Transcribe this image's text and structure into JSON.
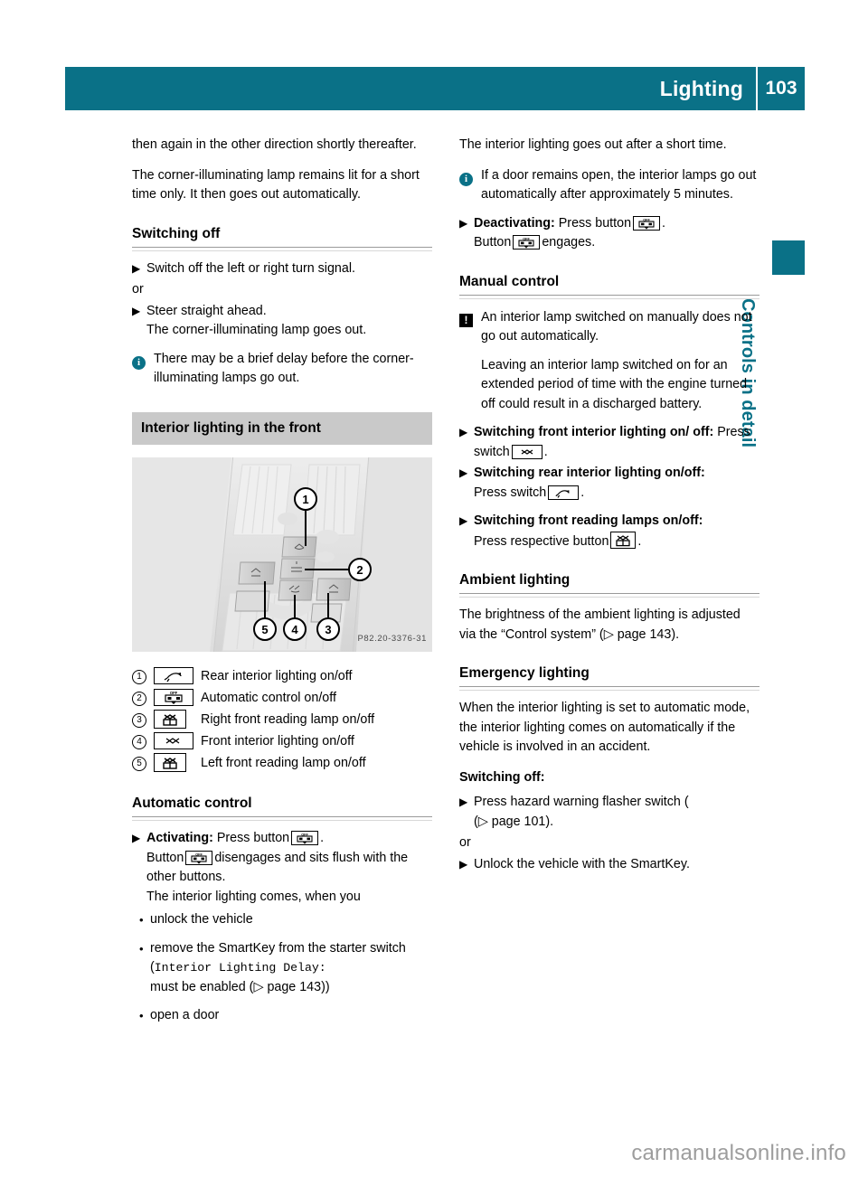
{
  "header": {
    "title": "Lighting",
    "page_number": "103"
  },
  "side_tab": {
    "label": "Controls in detail"
  },
  "left_column": {
    "intro_para_1": "then again in the other direction shortly thereafter.",
    "intro_para_2": "The corner-illuminating lamp remains lit for a short time only. It then goes out automatically.",
    "switching_off": {
      "heading": "Switching off",
      "step_1": "Switch off the left or right turn signal.",
      "or_label": "or",
      "step_2": "Steer straight ahead.",
      "step_2_sub": "The corner-illuminating lamp goes out.",
      "note": "There may be a brief delay before the corner-illuminating lamps go out."
    },
    "figure": {
      "banner": "Interior lighting in the front",
      "figure_id": "P82.20-3376-31",
      "callouts": [
        "1",
        "2",
        "3",
        "4",
        "5"
      ]
    },
    "legend": [
      {
        "number": "1",
        "icon": "rear-interior-lighting-icon",
        "text": "Rear interior lighting on/off"
      },
      {
        "number": "2",
        "icon": "automatic-control-icon",
        "text": "Automatic control on/off"
      },
      {
        "number": "3",
        "icon": "reading-lamp-icon",
        "text": "Right front reading lamp on/off"
      },
      {
        "number": "4",
        "icon": "front-interior-lighting-icon",
        "text": "Front interior lighting on/off"
      },
      {
        "number": "5",
        "icon": "reading-lamp-icon",
        "text": "Left front reading lamp on/off"
      }
    ],
    "automatic_control": {
      "heading": "Automatic control",
      "step_label": "Activating:",
      "step_text_before": "Press button",
      "step_text_after": ".",
      "sub_line_1_before": "Button",
      "sub_line_1_after": "disengages and sits flush with the other buttons.",
      "sub_line_2": "The interior lighting comes, when you",
      "bullets": [
        {
          "text": "unlock the vehicle"
        },
        {
          "text_before": "remove the SmartKey from the starter switch (",
          "mono": "Interior Lighting Delay:",
          "text_after": "must be enabled (",
          "ref": "page 143",
          "text_end": "))"
        },
        {
          "text": "open a door"
        }
      ]
    }
  },
  "right_column": {
    "intro_para": "The interior lighting goes out after a short time.",
    "info_note": "If a door remains open, the interior lamps go out automatically after approximately 5 minutes.",
    "deactivating": {
      "label": "Deactivating:",
      "text_before": "Press button",
      "text_after": ".",
      "sub_before": "Button",
      "sub_after": "engages."
    },
    "manual_control": {
      "heading": "Manual control",
      "warning": "An interior lamp switched on manually does not go out automatically.",
      "warning_para_2": "Leaving an interior lamp switched on for an extended period of time with the engine turned off could result in a discharged battery.",
      "step_1_label": "Switching front interior lighting on/ off:",
      "step_1_text_before": "Press switch",
      "step_1_text_after": ".",
      "step_2_label": "Switching rear interior lighting on/off:",
      "step_2_text_before": "Press switch",
      "step_2_text_after": ".",
      "step_3_label": "Switching front reading lamps on/off:",
      "step_3_text_before": "Press respective button",
      "step_3_text_after": "."
    },
    "ambient_lighting": {
      "heading": "Ambient lighting",
      "text_before": "The brightness of the ambient lighting is adjusted via the “Control system” (",
      "ref": "page 143",
      "text_after": ")."
    },
    "emergency_lighting": {
      "heading": "Emergency lighting",
      "para": "When the interior lighting is set to automatic mode, the interior lighting comes on automatically if the vehicle is involved in an accident.",
      "switching_off_label": "Switching off:",
      "step_1_before": "Press hazard warning flasher switch (",
      "step_1_ref": "page 101",
      "step_1_after": ").",
      "or_label": "or",
      "step_2": "Unlock the vehicle with the SmartKey."
    }
  },
  "watermark": "carmanualsonline.info",
  "colors": {
    "brand_teal": "#0a7187",
    "banner_grey": "#c9c9c9",
    "watermark_grey": "#9d9d9d"
  }
}
